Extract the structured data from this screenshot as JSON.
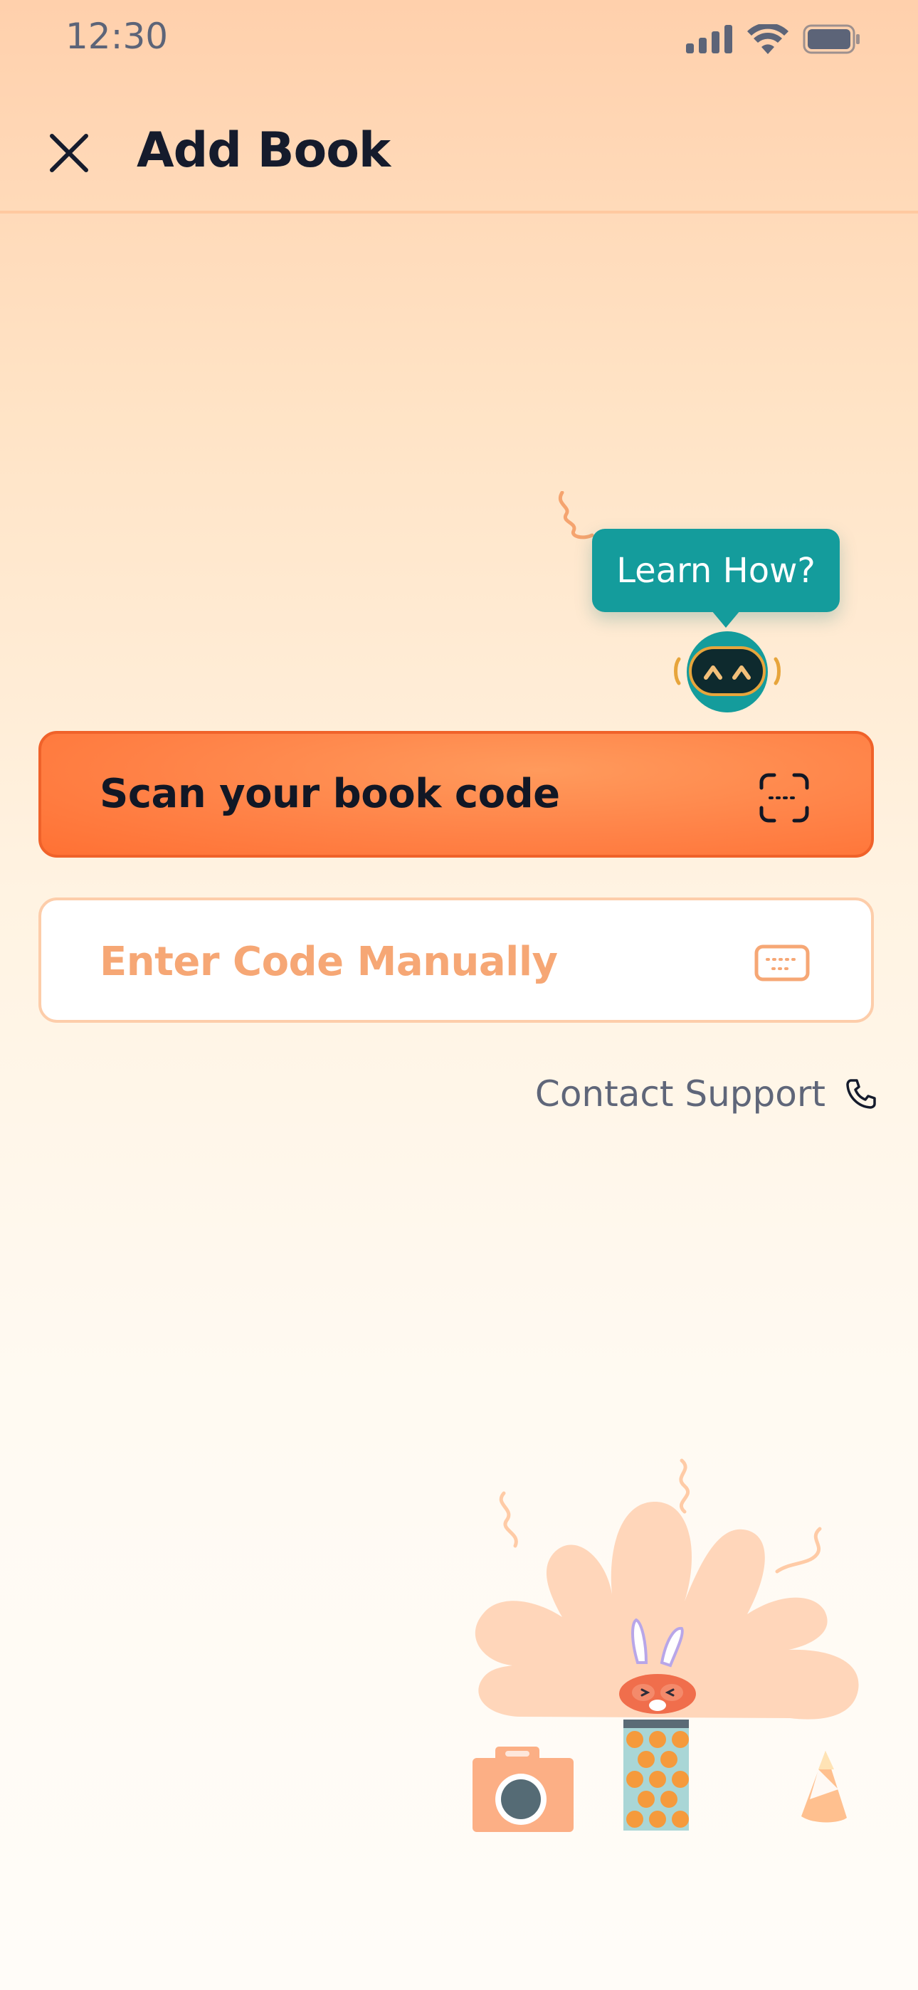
{
  "status_bar": {
    "time": "12:30"
  },
  "header": {
    "title": "Add Book"
  },
  "helper": {
    "bubble_text": "Learn How?"
  },
  "actions": {
    "scan_label": "Scan your book code",
    "manual_label": "Enter Code Manually"
  },
  "support": {
    "label": "Contact Support"
  },
  "icons": {
    "close": "close-icon",
    "scan": "scan-frame-icon",
    "keyboard": "keyboard-icon",
    "phone": "phone-icon",
    "signal": "signal-icon",
    "wifi": "wifi-icon",
    "battery": "battery-icon"
  },
  "colors": {
    "primary": "#FF8247",
    "teal": "#149C9C",
    "manual_text": "#F6A775",
    "title_text": "#151B2C"
  }
}
